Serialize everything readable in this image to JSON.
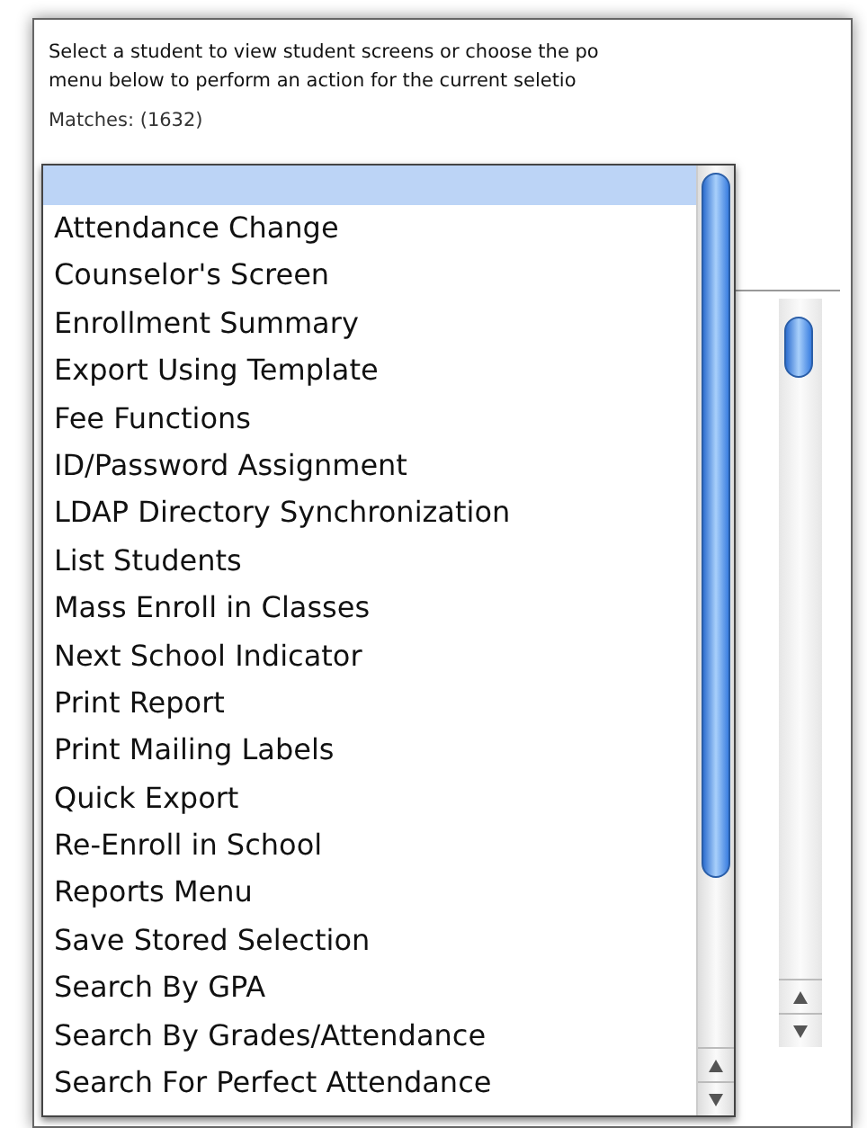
{
  "instructions": [
    "Select a student to view student screens or choose the po",
    "menu below to perform an action for the current seletio"
  ],
  "matches": "Matches: (1632)",
  "popup_menu": {
    "items": [
      {
        "kind": "blank",
        "selected": true
      },
      {
        "kind": "item",
        "label": "Attendance Change",
        "selected": false
      },
      {
        "kind": "item",
        "label": "Counselor's Screen",
        "selected": false
      },
      {
        "kind": "item",
        "label": "Enrollment Summary",
        "selected": false
      },
      {
        "kind": "item",
        "label": "Export Using Template",
        "selected": false
      },
      {
        "kind": "item",
        "label": "Fee Functions",
        "selected": false
      },
      {
        "kind": "item",
        "label": "ID/Password Assignment",
        "selected": false
      },
      {
        "kind": "item",
        "label": "LDAP Directory Synchronization",
        "selected": false
      },
      {
        "kind": "item",
        "label": "List Students",
        "selected": false
      },
      {
        "kind": "item",
        "label": "Mass Enroll in Classes",
        "selected": false
      },
      {
        "kind": "item",
        "label": "Next School Indicator",
        "selected": false
      },
      {
        "kind": "item",
        "label": "Print Report",
        "selected": false
      },
      {
        "kind": "item",
        "label": "Print Mailing Labels",
        "selected": false
      },
      {
        "kind": "item",
        "label": "Quick Export",
        "selected": false
      },
      {
        "kind": "item",
        "label": "Re-Enroll in School",
        "selected": false
      },
      {
        "kind": "item",
        "label": "Reports Menu",
        "selected": false
      },
      {
        "kind": "item",
        "label": "Save Stored Selection",
        "selected": false
      },
      {
        "kind": "item",
        "label": "Search By GPA",
        "selected": false
      },
      {
        "kind": "item",
        "label": "Search By Grades/Attendance",
        "selected": false
      },
      {
        "kind": "item",
        "label": "Search For Perfect Attendance",
        "selected": false
      }
    ]
  }
}
